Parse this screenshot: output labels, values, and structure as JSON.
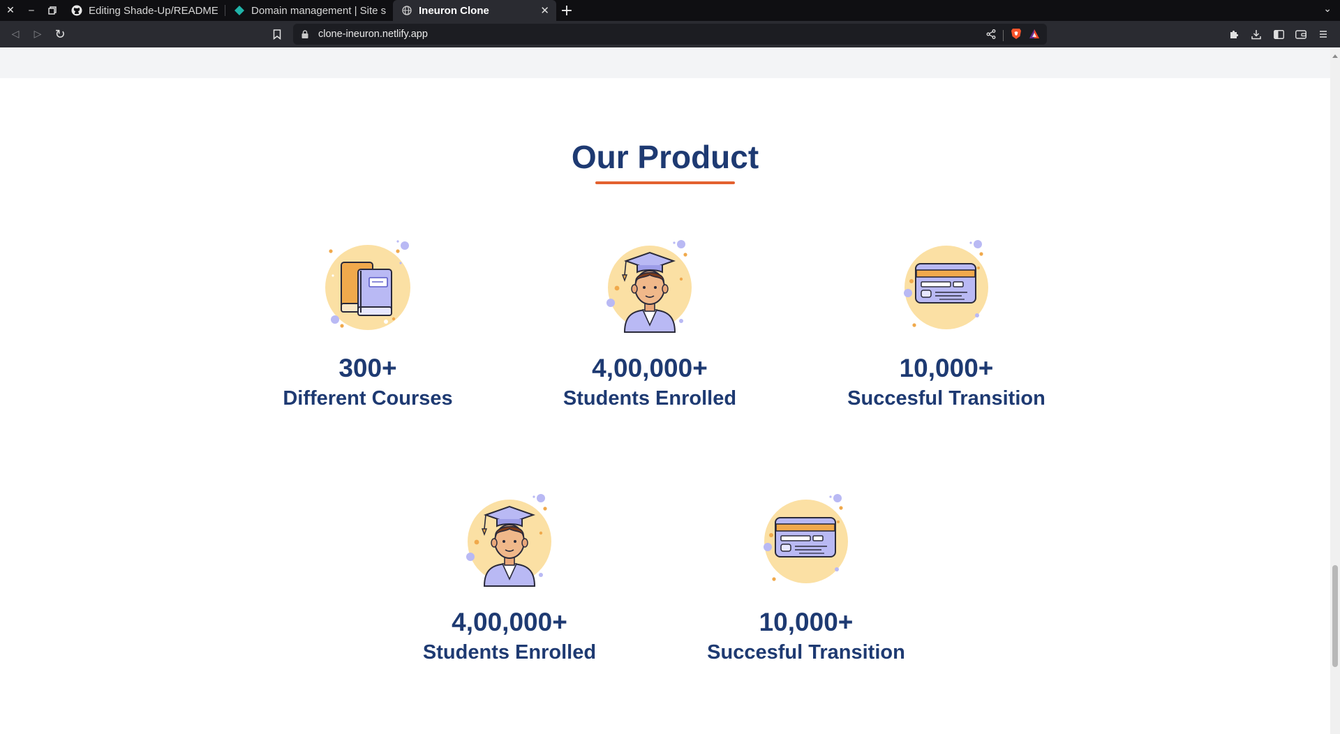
{
  "browser": {
    "tabs": [
      {
        "title": "Editing Shade-Up/README.m",
        "icon": "github-icon",
        "active": false
      },
      {
        "title": "Domain management | Site se",
        "icon": "netlify-icon",
        "active": false
      },
      {
        "title": "Ineuron Clone",
        "icon": "globe-icon",
        "active": true
      }
    ],
    "url": "clone-ineuron.netlify.app"
  },
  "section": {
    "title": "Our Product"
  },
  "stats": [
    {
      "value": "300+",
      "label": "Different Courses",
      "icon": "books-icon"
    },
    {
      "value": "4,00,000+",
      "label": "Students Enrolled",
      "icon": "graduate-icon"
    },
    {
      "value": "10,000+",
      "label": "Succesful Transition",
      "icon": "credit-card-icon"
    },
    {
      "value": "4,00,000+",
      "label": "Students Enrolled",
      "icon": "graduate-icon"
    },
    {
      "value": "10,000+",
      "label": "Succesful Transition",
      "icon": "credit-card-icon"
    }
  ],
  "colors": {
    "heading": "#1e3a72",
    "accent": "#e3612f",
    "icon_circle": "#fbe0a4",
    "icon_lilac": "#b9b9f4",
    "icon_orange": "#f0a94c"
  }
}
